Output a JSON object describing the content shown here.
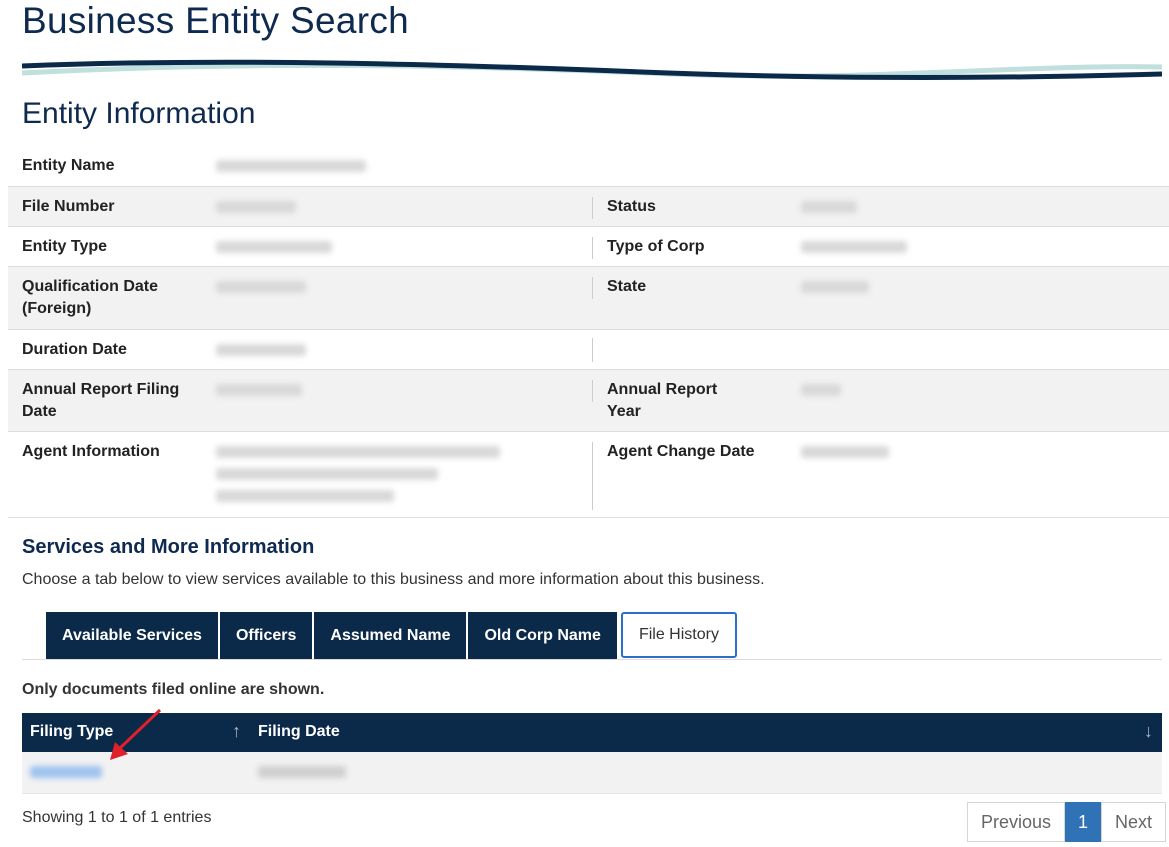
{
  "page_title": "Business Entity Search",
  "section_title": "Entity Information",
  "entity": {
    "entity_name_label": "Entity Name",
    "file_number_label": "File Number",
    "status_label": "Status",
    "entity_type_label": "Entity Type",
    "type_of_corp_label": "Type of Corp",
    "qualification_date_label": "Qualification Date (Foreign)",
    "state_label": "State",
    "duration_date_label": "Duration Date",
    "annual_report_filing_date_label": "Annual Report Filing Date",
    "annual_report_year_label": "Annual Report Year",
    "agent_information_label": "Agent Information",
    "agent_change_date_label": "Agent Change Date"
  },
  "services": {
    "title": "Services and More Information",
    "description": "Choose a tab below to view services available to this business and more information about this business.",
    "tabs": [
      "Available Services",
      "Officers",
      "Assumed Name",
      "Old Corp Name",
      "File History"
    ],
    "active_tab": "File History"
  },
  "file_history": {
    "note": "Only documents filed online are shown.",
    "columns": [
      "Filing Type",
      "Filing Date"
    ],
    "showing": "Showing 1 to 1 of 1 entries"
  },
  "pagination": {
    "previous": "Previous",
    "current_page": "1",
    "next": "Next"
  },
  "colors": {
    "navy": "#0b2a4a",
    "accent_blue": "#2f72b6",
    "wave_teal": "#bfe0dc",
    "annotation_red": "#e0202a"
  }
}
